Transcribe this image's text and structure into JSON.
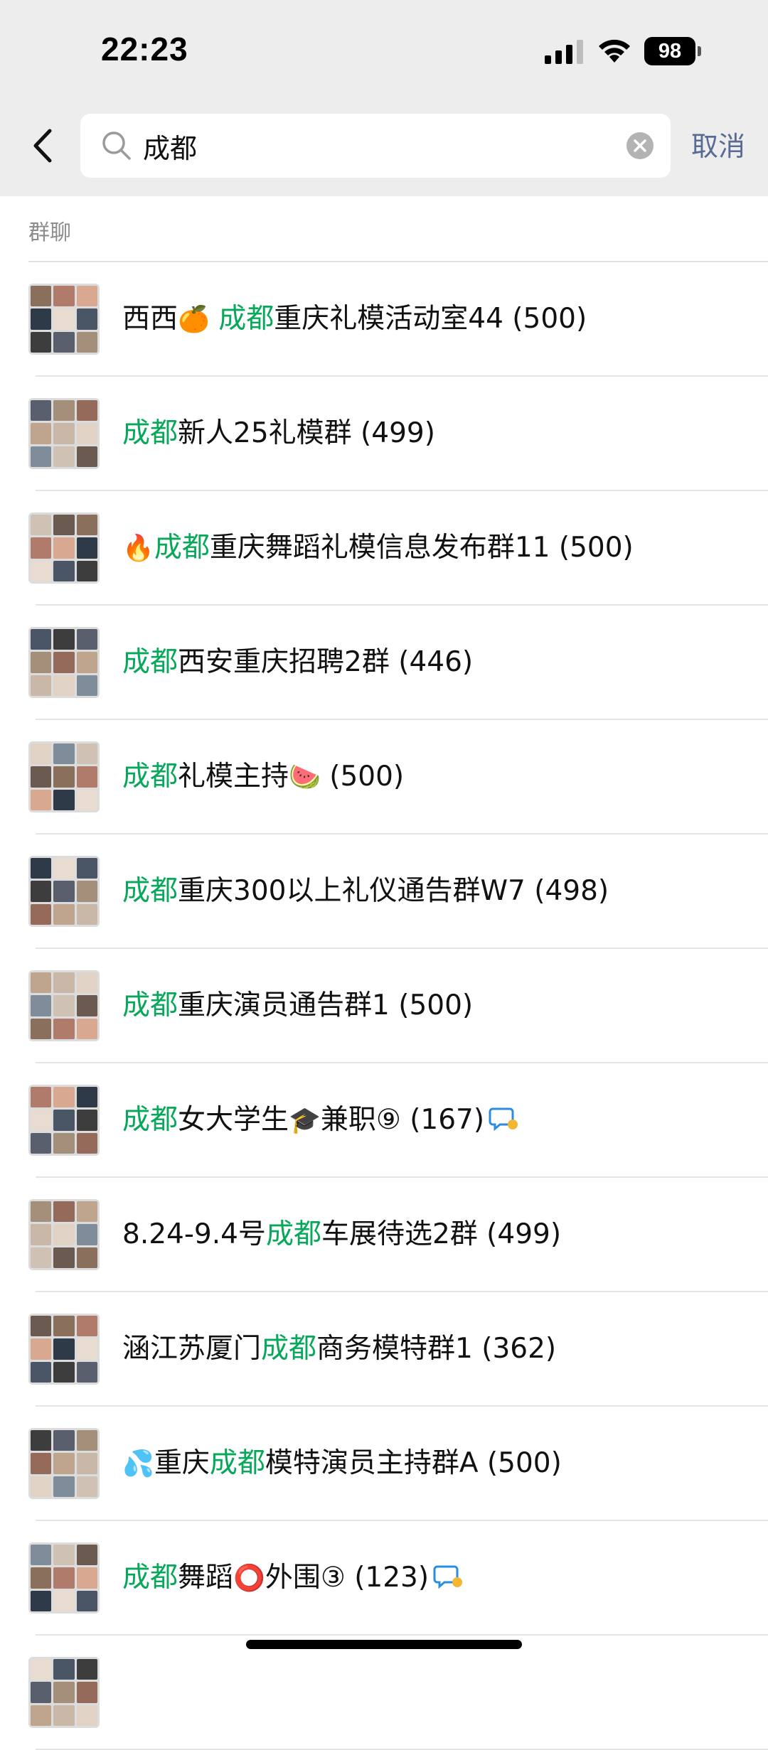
{
  "status_bar": {
    "time": "22:23",
    "battery": "98"
  },
  "search": {
    "query": "成都",
    "cancel_label": "取消"
  },
  "section": {
    "title": "群聊"
  },
  "results": [
    {
      "parts": [
        {
          "t": "西西"
        },
        {
          "t": "🍊",
          "e": true
        },
        {
          "t": " "
        },
        {
          "t": "成都",
          "h": true
        },
        {
          "t": "重庆礼模活动室44 (500)"
        }
      ]
    },
    {
      "parts": [
        {
          "t": "成都",
          "h": true
        },
        {
          "t": "新人25礼模群 (499)"
        }
      ]
    },
    {
      "parts": [
        {
          "t": "🔥",
          "e": true
        },
        {
          "t": "成都",
          "h": true
        },
        {
          "t": "重庆舞蹈礼模信息发布群11 (500)"
        }
      ]
    },
    {
      "parts": [
        {
          "t": "成都",
          "h": true
        },
        {
          "t": "西安重庆招聘2群 (446)"
        }
      ]
    },
    {
      "parts": [
        {
          "t": "成都",
          "h": true
        },
        {
          "t": "礼模主持"
        },
        {
          "t": "🍉",
          "e": true
        },
        {
          "t": " (500)"
        }
      ]
    },
    {
      "parts": [
        {
          "t": "成都",
          "h": true
        },
        {
          "t": "重庆300以上礼仪通告群W7 (498)"
        }
      ]
    },
    {
      "parts": [
        {
          "t": "成都",
          "h": true
        },
        {
          "t": "重庆演员通告群1 (500)"
        }
      ]
    },
    {
      "parts": [
        {
          "t": "成都",
          "h": true
        },
        {
          "t": "女大学生"
        },
        {
          "t": "🎓",
          "e": true
        },
        {
          "t": "兼职⑨ (167)"
        }
      ],
      "badge": true
    },
    {
      "parts": [
        {
          "t": "8.24-9.4号"
        },
        {
          "t": "成都",
          "h": true
        },
        {
          "t": "车展待选2群 (499)"
        }
      ]
    },
    {
      "parts": [
        {
          "t": "涵江苏厦门"
        },
        {
          "t": "成都",
          "h": true
        },
        {
          "t": "商务模特群1 (362)"
        }
      ]
    },
    {
      "parts": [
        {
          "t": "💦",
          "e": true
        },
        {
          "t": "重庆"
        },
        {
          "t": "成都",
          "h": true
        },
        {
          "t": "模特演员主持群A (500)"
        }
      ]
    },
    {
      "parts": [
        {
          "t": "成都",
          "h": true
        },
        {
          "t": "舞蹈"
        },
        {
          "t": "⭕",
          "e": true
        },
        {
          "t": "外围③ (123)"
        }
      ],
      "badge": true
    },
    {
      "parts": []
    }
  ],
  "colors": {
    "highlight": "#07a85a",
    "link": "#576b95",
    "header_bg": "#ededed"
  }
}
